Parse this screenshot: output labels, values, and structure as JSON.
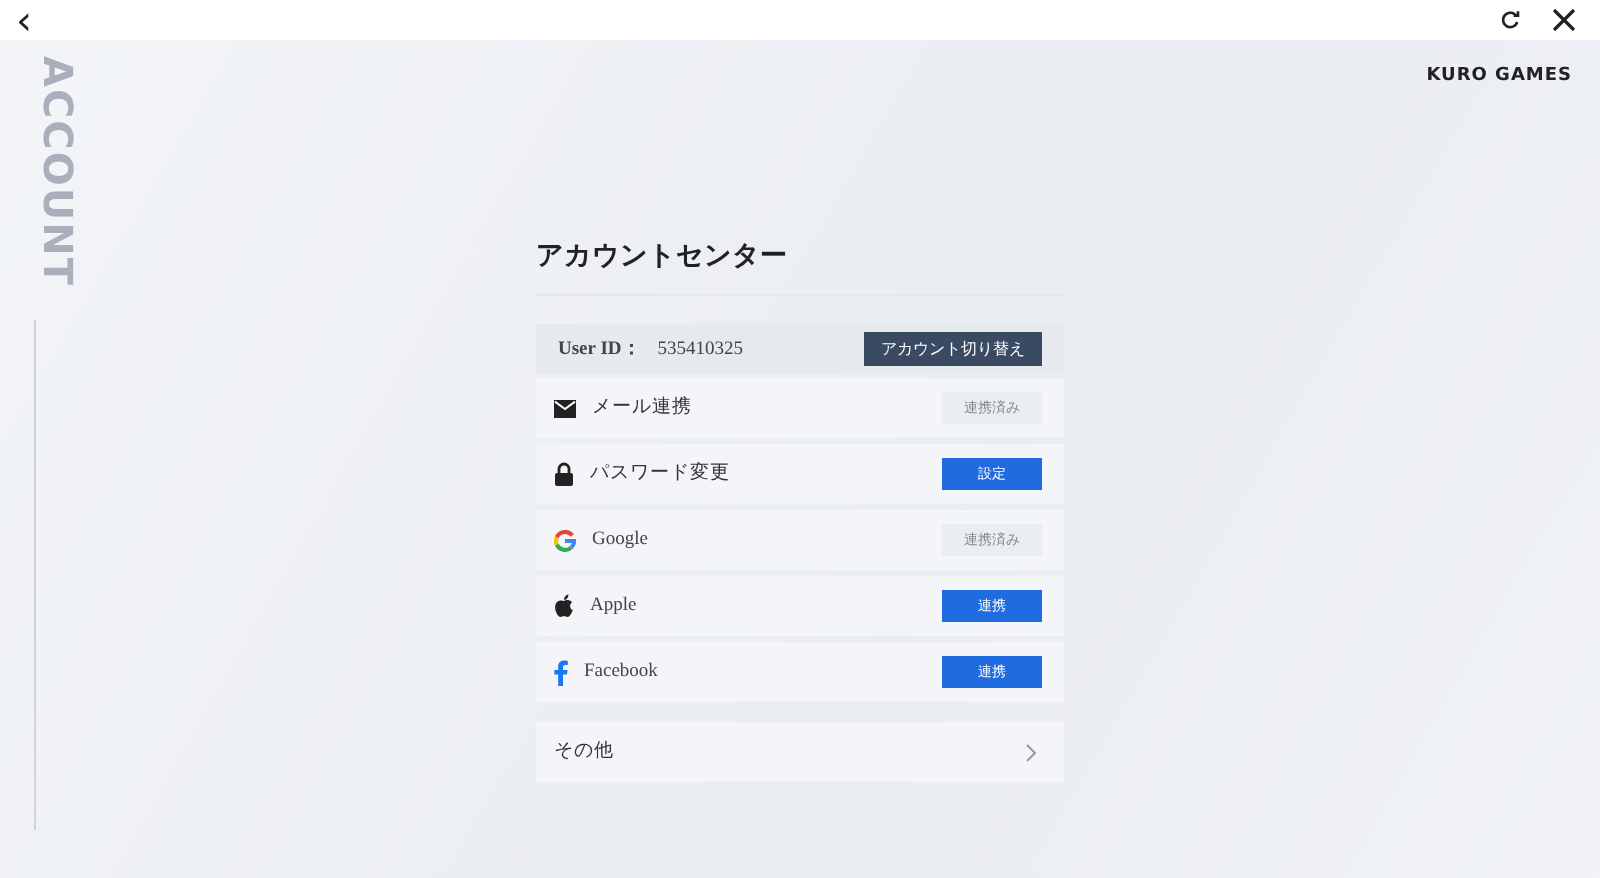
{
  "top_bar": {
    "back": "‹",
    "brand": "KURO GAMES"
  },
  "side_label": "ACCOUNT",
  "title": "アカウントセンター",
  "user_id": {
    "label": "User ID：",
    "value": "535410325",
    "button": "アカウント切り替え"
  },
  "bindings": [
    {
      "label": "メール連携",
      "button": "連携済み",
      "linked": true
    },
    {
      "label": "パスワード変更",
      "button": "設定",
      "linked": false
    },
    {
      "label": "Google",
      "button": "連携済み",
      "linked": true
    },
    {
      "label": "Apple",
      "button": "連携",
      "linked": false
    },
    {
      "label": "Facebook",
      "button": "連携",
      "linked": false
    }
  ],
  "other": {
    "label": "その他"
  }
}
